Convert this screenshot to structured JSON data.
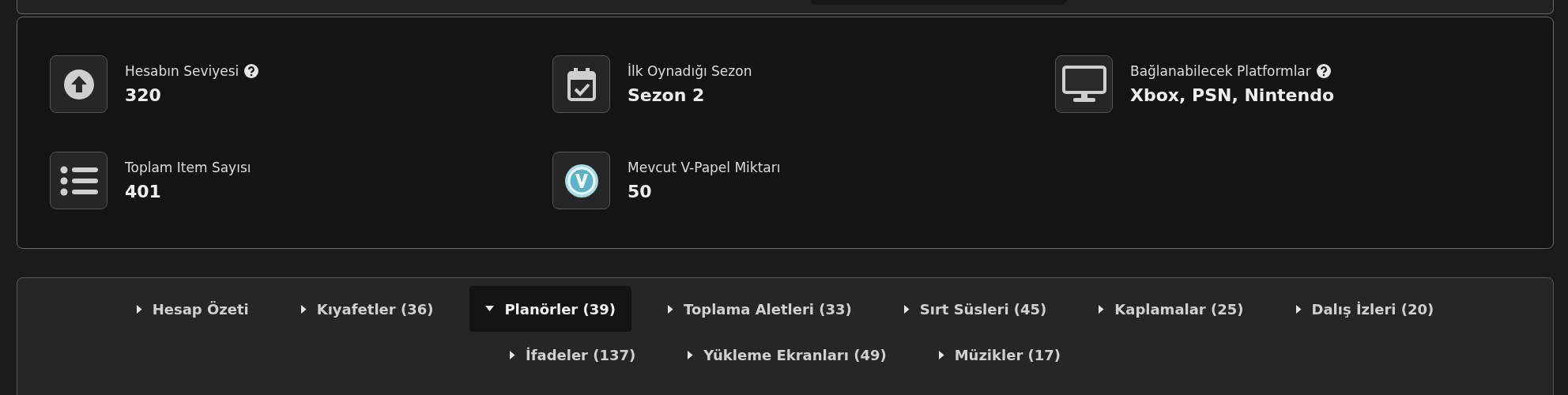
{
  "stats": [
    {
      "label": "Hesabın Seviyesi",
      "value": "320",
      "help": true
    },
    {
      "label": "İlk Oynadığı Sezon",
      "value": "Sezon 2",
      "help": false
    },
    {
      "label": "Bağlanabilecek Platformlar",
      "value": "Xbox, PSN, Nintendo",
      "help": true
    },
    {
      "label": "Toplam Item Sayısı",
      "value": "401",
      "help": false
    },
    {
      "label": "Mevcut V-Papel Miktarı",
      "value": "50",
      "help": false
    }
  ],
  "tabs": [
    {
      "label": "Hesap Özeti",
      "selected": false
    },
    {
      "label": "Kıyafetler (36)",
      "selected": false
    },
    {
      "label": "Planörler (39)",
      "selected": true
    },
    {
      "label": "Toplama Aletleri (33)",
      "selected": false
    },
    {
      "label": "Sırt Süsleri (45)",
      "selected": false
    },
    {
      "label": "Kaplamalar (25)",
      "selected": false
    },
    {
      "label": "Dalış İzleri (20)",
      "selected": false
    },
    {
      "label": "İfadeler (137)",
      "selected": false
    },
    {
      "label": "Yükleme Ekranları (49)",
      "selected": false
    },
    {
      "label": "Müzikler (17)",
      "selected": false
    }
  ]
}
